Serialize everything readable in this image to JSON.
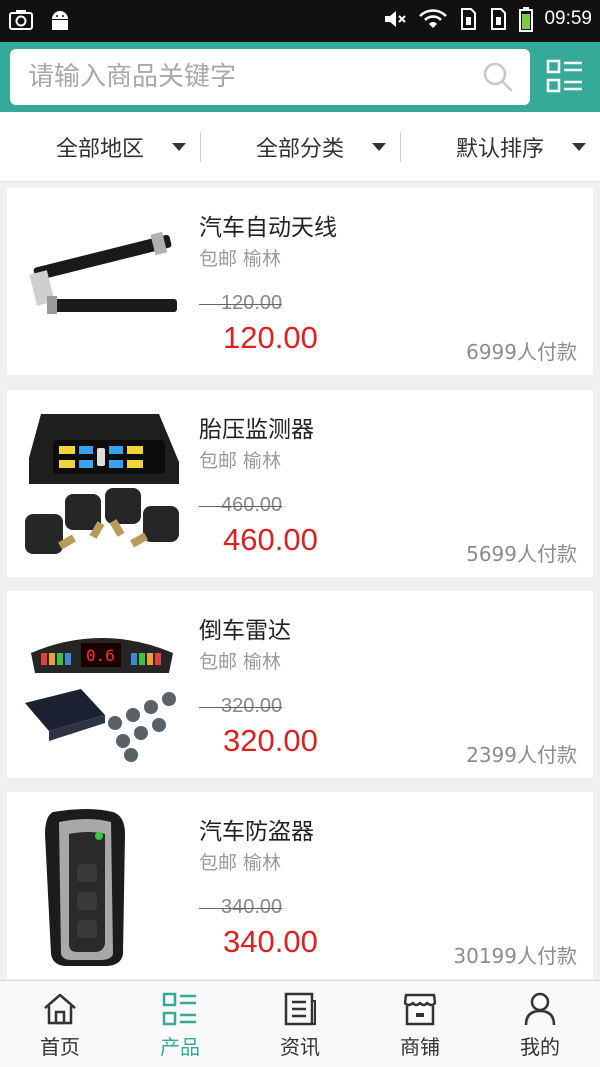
{
  "status_bar": {
    "time": "09:59",
    "left_icons": [
      "camera-icon",
      "android-icon"
    ],
    "right_icons": [
      "mute-icon",
      "wifi-icon",
      "sim1-icon",
      "sim2-icon",
      "battery-icon"
    ]
  },
  "search": {
    "placeholder": "请输入商品关键字",
    "value": ""
  },
  "filters": [
    {
      "label": "全部地区"
    },
    {
      "label": "全部分类"
    },
    {
      "label": "默认排序"
    }
  ],
  "products": [
    {
      "name": "汽车自动天线",
      "tag": "包邮 榆林",
      "original_price": "120.00",
      "price": "120.00",
      "sold": "6999人付款",
      "image": "car-antenna-image"
    },
    {
      "name": "胎压监测器",
      "tag": "包邮 榆林",
      "original_price": "460.00",
      "price": "460.00",
      "sold": "5699人付款",
      "image": "tire-pressure-monitor-image"
    },
    {
      "name": "倒车雷达",
      "tag": "包邮 榆林",
      "original_price": "320.00",
      "price": "320.00",
      "sold": "2399人付款",
      "image": "parking-sensor-image"
    },
    {
      "name": "汽车防盗器",
      "tag": "包邮 榆林",
      "original_price": "340.00",
      "price": "340.00",
      "sold": "30199人付款",
      "image": "car-key-remote-image"
    }
  ],
  "bottom_nav": [
    {
      "label": "首页",
      "icon": "home-icon"
    },
    {
      "label": "产品",
      "icon": "grid-list-icon",
      "active": true
    },
    {
      "label": "资讯",
      "icon": "news-icon"
    },
    {
      "label": "商铺",
      "icon": "shop-icon"
    },
    {
      "label": "我的",
      "icon": "user-icon"
    }
  ],
  "colors": {
    "accent": "#36aa98",
    "price": "#e02020",
    "status_bar": "#111111"
  }
}
